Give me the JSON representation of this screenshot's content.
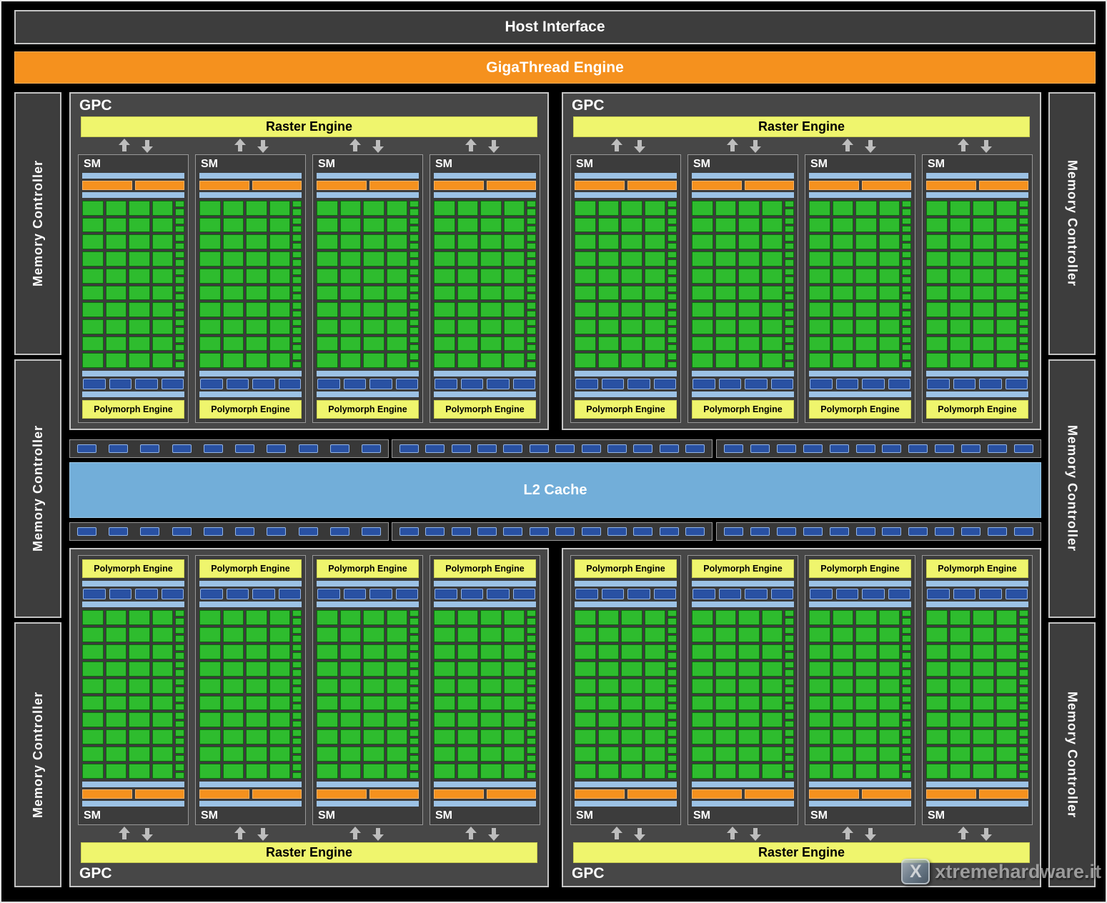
{
  "diagram": {
    "host_interface": "Host Interface",
    "gigathread_engine": "GigaThread Engine",
    "memory_controller": "Memory Controller",
    "gpc_label": "GPC",
    "raster_engine": "Raster Engine",
    "sm_label": "SM",
    "polymorph_engine": "Polymorph Engine",
    "l2_cache": "L2 Cache",
    "sms_per_gpc": 4,
    "core_grid": {
      "rows": 10,
      "cols": 4
    }
  },
  "watermark": {
    "logo_letter": "X",
    "text": "xtremehardware.it"
  },
  "colors": {
    "panel_gray": "#3d3d3d",
    "gpc_gray": "#474747",
    "orange": "#f5911e",
    "yellow": "#eff56d",
    "light_blue": "#9cc2e5",
    "l2_blue": "#72aed9",
    "dark_blue": "#2951a3",
    "core_green": "#2ebc2e"
  }
}
